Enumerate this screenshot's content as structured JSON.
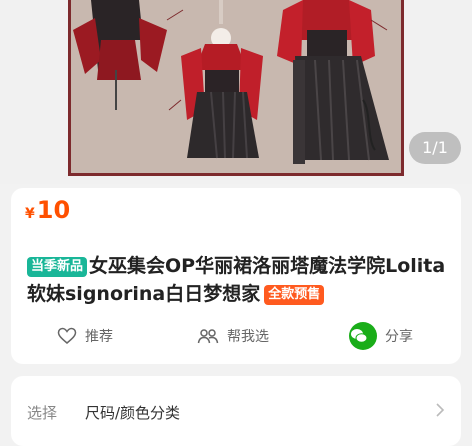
{
  "gallery": {
    "page_indicator": "1/1",
    "image_label": "女巫集会 Lolita 服装设定图"
  },
  "product": {
    "currency": "¥",
    "price": "10",
    "tag_new": "当季新品",
    "title": "女巫集会OP华丽裙洛丽塔魔法学院Lolita软妹signorina白日梦想家",
    "tag_presale": "全款预售"
  },
  "actions": {
    "recommend": "推荐",
    "help_choose": "帮我选",
    "share": "分享"
  },
  "selection": {
    "label": "选择",
    "value": "尺码/颜色分类"
  },
  "colors": {
    "price": "#ff5000",
    "tag_new": "#19b698",
    "tag_presale": "#ff5a1f",
    "wechat": "#1aad19",
    "art_frame": "#7d2a2d"
  }
}
